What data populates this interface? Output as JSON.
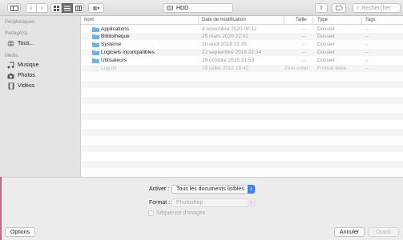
{
  "toolbar": {
    "path_label": "HDD",
    "search_placeholder": "Rechercher"
  },
  "sidebar": {
    "sections": [
      {
        "title": "Périphériques"
      },
      {
        "title": "Partagé(s)"
      },
      {
        "title": "Média"
      }
    ],
    "shared_items": [
      {
        "label": "Tous...",
        "icon": "globe-icon"
      }
    ],
    "media_items": [
      {
        "label": "Musique",
        "icon": "music-icon"
      },
      {
        "label": "Photos",
        "icon": "camera-icon"
      },
      {
        "label": "Vidéos",
        "icon": "film-icon"
      }
    ]
  },
  "list": {
    "columns": [
      "Nom",
      "Date de modification",
      "Taille",
      "Type",
      "Tags"
    ],
    "rows": [
      {
        "name": "Applications",
        "date": "8 novembre 2020 00:12",
        "size": "--",
        "type": "Dossier",
        "tags": "--",
        "kind": "folder"
      },
      {
        "name": "Bibliothèque",
        "date": "25 mars 2020 22:01",
        "size": "--",
        "type": "Dossier",
        "tags": "--",
        "kind": "folder"
      },
      {
        "name": "Système",
        "date": "20 août 2018 22:38",
        "size": "--",
        "type": "Dossier",
        "tags": "--",
        "kind": "folder"
      },
      {
        "name": "Logiciels incompatibles",
        "date": "22 septembre 2016 22:34",
        "size": "--",
        "type": "Dossier",
        "tags": "--",
        "kind": "folder"
      },
      {
        "name": "Utilisateurs",
        "date": "29 octobre 2015 21:53",
        "size": "--",
        "type": "Dossier",
        "tags": "--",
        "kind": "folder"
      },
      {
        "name": "Log.txt",
        "date": "15 juillet 2015 18:42",
        "size": "Zéro octet",
        "type": "Format texte",
        "tags": "--",
        "kind": "file"
      }
    ]
  },
  "options": {
    "activer_label": "Activer :",
    "activer_value": "Tous les documents lisibles",
    "format_label": "Format :",
    "format_value": "Photoshop",
    "sequence_label": "Séquence d'images"
  },
  "buttons": {
    "options": "Options",
    "cancel": "Annuler",
    "open": "Ouvrir"
  },
  "colors": {
    "accent": "#3b82f7",
    "folder": "#6cb2ec"
  }
}
